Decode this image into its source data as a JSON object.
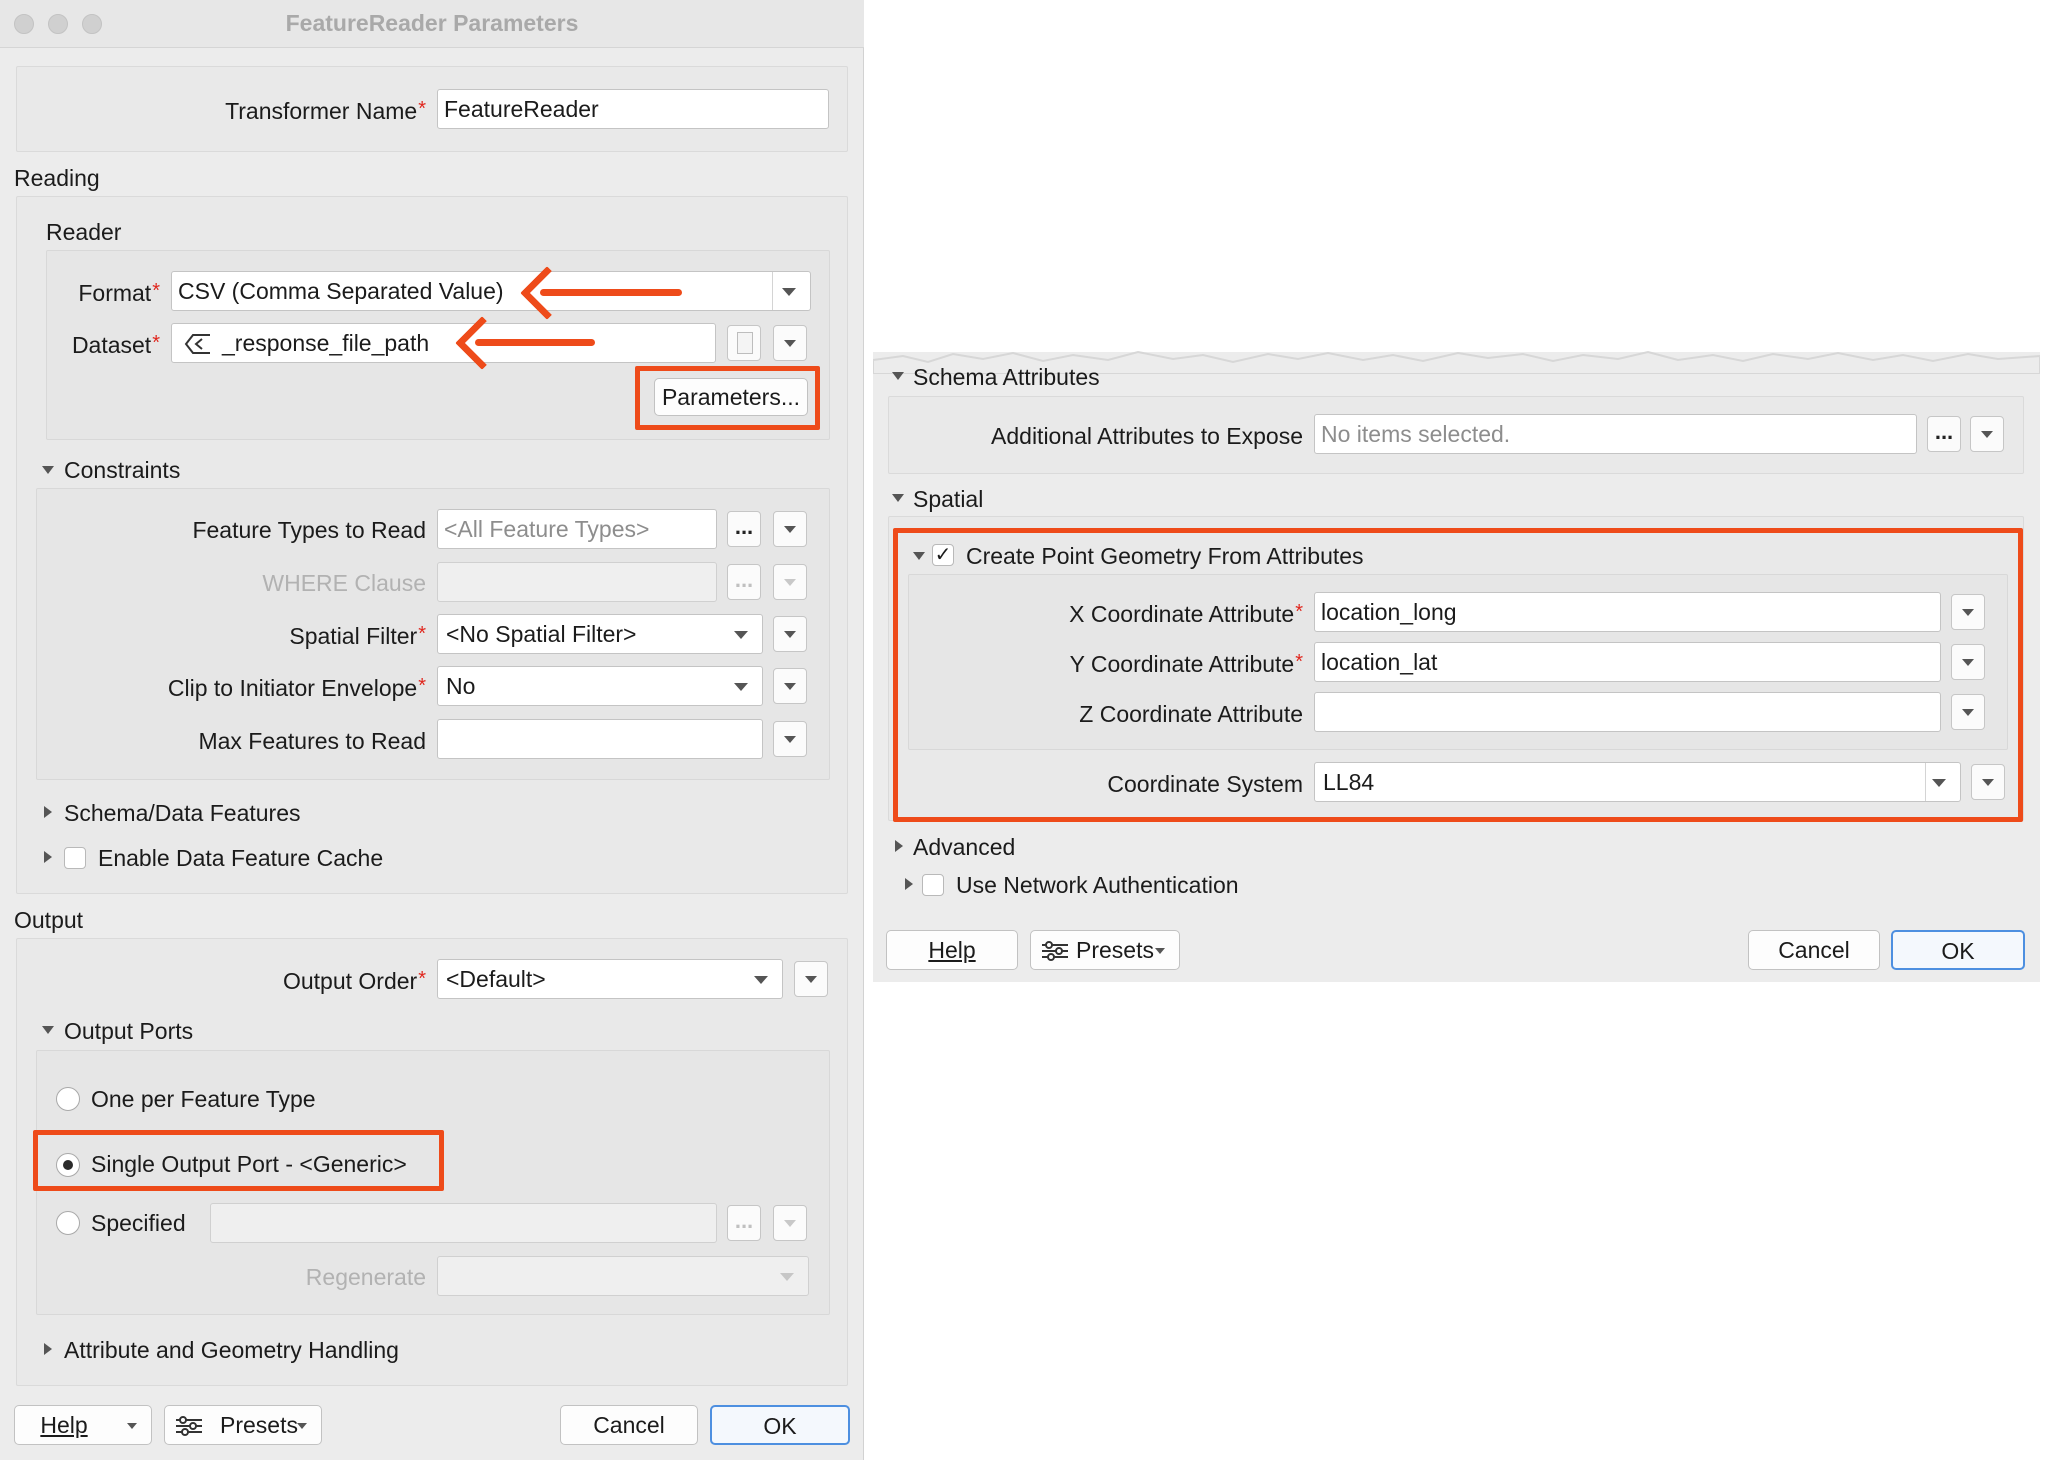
{
  "dialog1": {
    "title": "FeatureReader Parameters",
    "transformer_name_label": "Transformer Name",
    "transformer_name_value": "FeatureReader",
    "reading_section": "Reading",
    "reader_group": "Reader",
    "format_label": "Format",
    "format_value": "CSV (Comma Separated Value)",
    "dataset_label": "Dataset",
    "dataset_value": "_response_file_path",
    "parameters_button": "Parameters...",
    "constraints_section": "Constraints",
    "feature_types_label": "Feature Types to Read",
    "feature_types_placeholder": "<All Feature Types>",
    "where_clause_label": "WHERE Clause",
    "spatial_filter_label": "Spatial Filter",
    "spatial_filter_value": "<No Spatial Filter>",
    "clip_label": "Clip to Initiator Envelope",
    "clip_value": "No",
    "max_features_label": "Max Features to Read",
    "schema_data_features": "Schema/Data Features",
    "enable_cache": "Enable Data Feature Cache",
    "output_section": "Output",
    "output_order_label": "Output Order",
    "output_order_value": "<Default>",
    "output_ports_section": "Output Ports",
    "radio_one_per": "One per Feature Type",
    "radio_single": "Single Output Port - <Generic>",
    "radio_specified": "Specified",
    "regenerate_label": "Regenerate",
    "attr_geom_handling": "Attribute and Geometry Handling",
    "help_button": "Help",
    "presets_button": "Presets",
    "cancel_button": "Cancel",
    "ok_button": "OK",
    "dots": "..."
  },
  "dialog2": {
    "schema_attributes": "Schema Attributes",
    "additional_attrs_label": "Additional Attributes to Expose",
    "additional_attrs_placeholder": "No items selected.",
    "spatial_section": "Spatial",
    "create_point_label": "Create Point Geometry From Attributes",
    "create_point_checked": true,
    "x_label": "X Coordinate Attribute",
    "x_value": "location_long",
    "y_label": "Y Coordinate Attribute",
    "y_value": "location_lat",
    "z_label": "Z Coordinate Attribute",
    "z_value": "",
    "coord_system_label": "Coordinate System",
    "coord_system_value": "LL84",
    "advanced_section": "Advanced",
    "network_auth": "Use Network Authentication",
    "help_button": "Help",
    "presets_button": "Presets",
    "cancel_button": "Cancel",
    "ok_button": "OK",
    "dots": "..."
  },
  "required_marker": "*",
  "check_mark": "✓",
  "colors": {
    "highlight": "#ee4b1a",
    "required": "#e0261d",
    "ok_border": "#4d8fe0",
    "window_bg": "#ececec"
  }
}
